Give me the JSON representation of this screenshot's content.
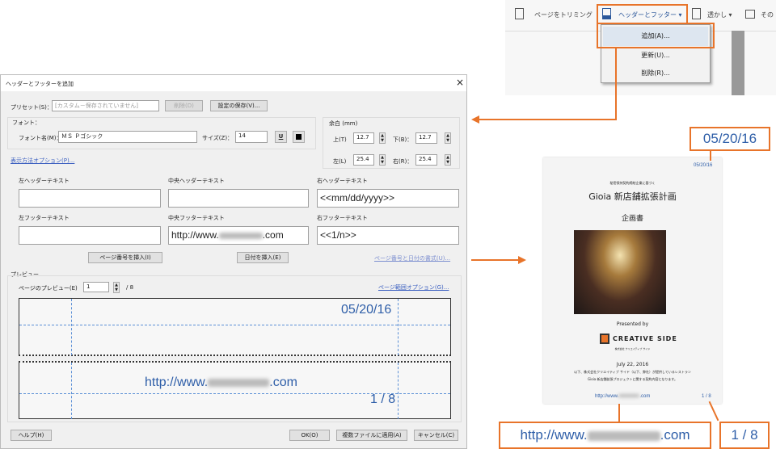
{
  "toolbar": {
    "trim": "ページをトリミング",
    "header_footer": "ヘッダーとフッター ▾",
    "watermark": "透かし ▾",
    "more": "その"
  },
  "menu": {
    "add": "追加(A)...",
    "update": "更新(U)...",
    "delete": "削除(R)..."
  },
  "dialog": {
    "title": "ヘッダーとフッターを追加",
    "close": "×",
    "preset_label": "プリセット(S)：",
    "preset_value": "[カスタム－保存されていません]",
    "delete_btn": "削除(D)",
    "save_btn": "設定の保存(V)...",
    "font_group": "フォント：",
    "font_name_label": "フォント名(M)：",
    "font_name": "ＭＳ Ｐゴシック",
    "size_label": "サイズ(Z)：",
    "size": "14",
    "underline": "U",
    "margin_group": "余白 (mm)",
    "top_label": "上(T)",
    "top": "12.7",
    "bottom_label": "下(B)：",
    "bottom": "12.7",
    "left_label": "左(L)",
    "left": "25.4",
    "right_label": "右(R)：",
    "right": "25.4",
    "appearance_link": "表示方法オプション(P)...",
    "left_header_label": "左ヘッダーテキスト",
    "center_header_label": "中央ヘッダーテキスト",
    "right_header_label": "右ヘッダーテキスト",
    "left_header": "",
    "center_header": "",
    "right_header": "<<mm/dd/yyyy>>",
    "left_footer_label": "左フッターテキスト",
    "center_footer_label": "中央フッターテキスト",
    "right_footer_label": "右フッターテキスト",
    "left_footer": "",
    "center_footer_prefix": "http://www.",
    "center_footer_suffix": ".com",
    "right_footer": "<<1/n>>",
    "insert_page_btn": "ページ番号を挿入(I)",
    "insert_date_btn": "日付を挿入(E)",
    "format_link": "ページ番号と日付の書式(U)...",
    "preview_group": "プレビュー",
    "preview_page_label": "ページのプレビュー(E)",
    "preview_page": "1",
    "preview_total": "/ 8",
    "page_range_link": "ページ範囲オプション(G)...",
    "preview_date": "05/20/16",
    "preview_url_prefix": "http://www.",
    "preview_url_suffix": ".com",
    "preview_page_num": "1 / 8",
    "help_btn": "ヘルプ(H)",
    "ok_btn": "OK(O)",
    "apply_multi_btn": "複数ファイルに適用(A)",
    "cancel_btn": "キャンセル(C)"
  },
  "page": {
    "date": "05/20/16",
    "subtitle": "秘密保持契約締結企業に基づく",
    "title": "Gioia 新店舗拡張計画",
    "doc": "企画書",
    "presented": "Presented by",
    "logo": "CREATIVE SIDE",
    "logo_sub": "株式会社 クリエイティブ サイド",
    "date2": "July 22, 2016",
    "body1": "以下、株式会社クリエイティブ サイド（以下、弊社）が提供しているレストラン",
    "body2": "Gioia 新店舗拡張プロジェクトに関する契約内容となります。",
    "url_prefix": "http://www.",
    "url_suffix": ".com",
    "pagenum": "1 / 8"
  },
  "callouts": {
    "date": "05/20/16",
    "url_prefix": "http://www.",
    "url_suffix": ".com",
    "pagenum": "1 / 8"
  },
  "colors": {
    "accent": "#e8742a",
    "link": "#2e5ea8"
  }
}
